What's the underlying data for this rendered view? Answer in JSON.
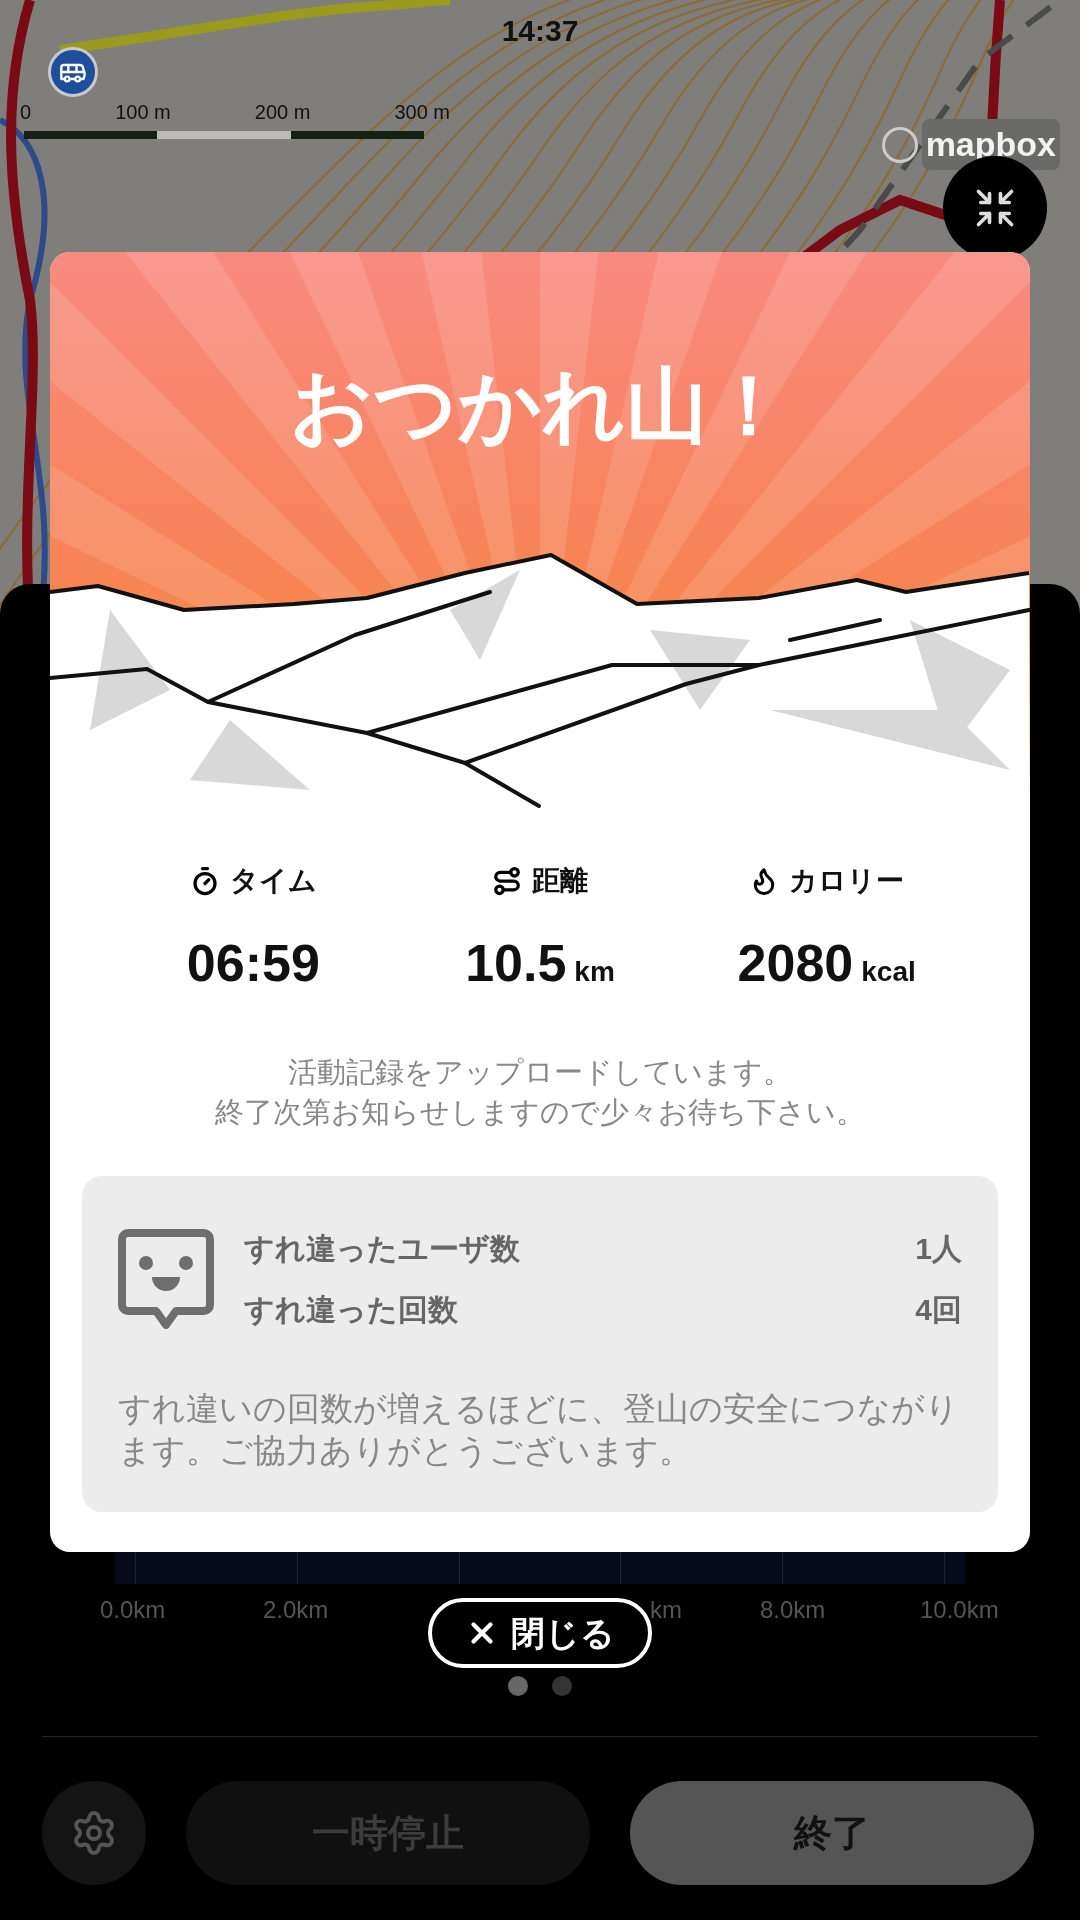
{
  "status_bar": {
    "time": "14:37"
  },
  "map": {
    "scale_labels": [
      "0",
      "100 m",
      "200 m",
      "300 m"
    ],
    "attribution": "mapbox"
  },
  "modal": {
    "title": "おつかれ山！",
    "stats": [
      {
        "kind": "time",
        "label": "タイム",
        "value": "06:59"
      },
      {
        "kind": "distance",
        "label": "距離",
        "value": "10.5",
        "unit": "km"
      },
      {
        "kind": "calories",
        "label": "カロリー",
        "value": "2080",
        "unit": "kcal"
      }
    ],
    "message": [
      "活動記録をアップロードしています。",
      "終了次第お知らせしますので少々お待ち下さい。"
    ],
    "passing": {
      "rows": [
        {
          "label": "すれ違ったユーザ数",
          "value": "1人"
        },
        {
          "label": "すれ違った回数",
          "value": "4回"
        }
      ],
      "note": "すれ違いの回数が増えるほどに、登山の安全につながります。ご協力ありがとうございます。"
    }
  },
  "close_button": {
    "label": "閉じる"
  },
  "chart_axis": {
    "left": [
      "0.0km",
      "2.0km"
    ],
    "middle": "km",
    "right": [
      "8.0km",
      "10.0km"
    ]
  },
  "pager": [
    {
      "selected": true
    },
    {
      "selected": false
    }
  ],
  "buttons": {
    "pause": "一時停止",
    "end": "終了"
  }
}
